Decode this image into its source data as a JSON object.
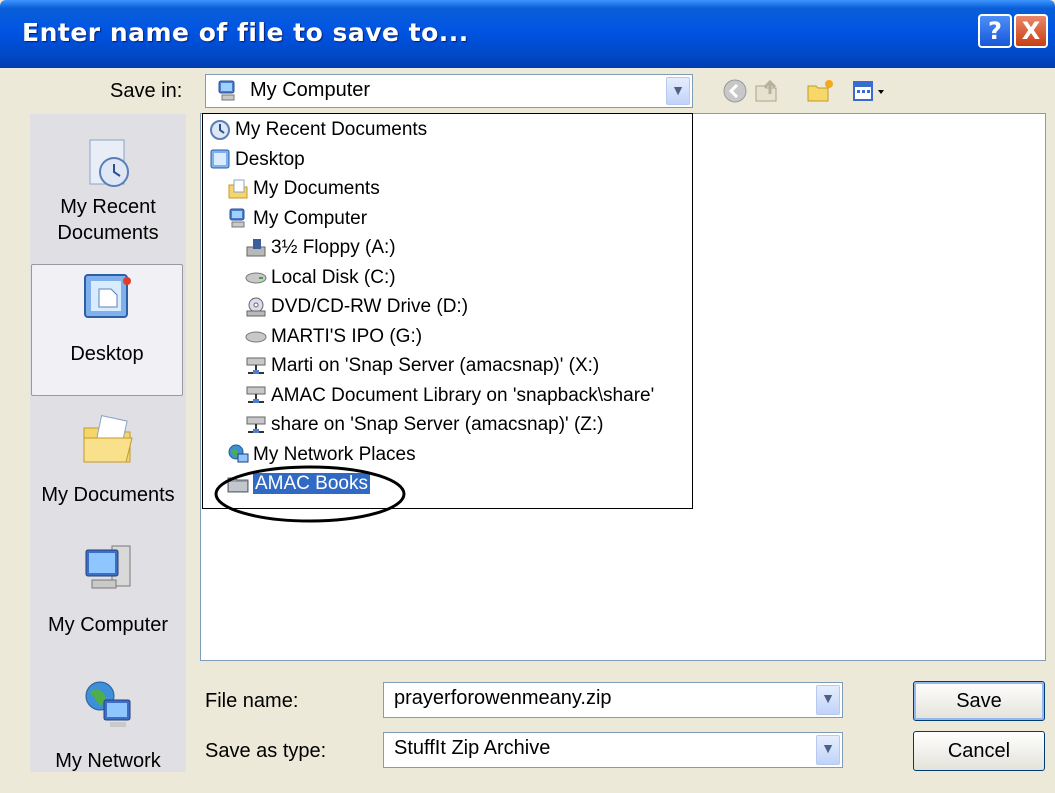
{
  "window": {
    "title": "Enter name of file to save to...",
    "help_label": "?",
    "close_label": "X"
  },
  "save_in": {
    "label": "Save in:",
    "value": "My Computer"
  },
  "toolbar": {
    "icons": [
      "back-icon",
      "up-folder-icon",
      "new-folder-icon",
      "views-menu-icon"
    ]
  },
  "places_bar": [
    {
      "label": "My Recent Documents",
      "icon": "recent-documents-icon"
    },
    {
      "label": "Desktop",
      "icon": "desktop-icon",
      "selected": true
    },
    {
      "label": "My Documents",
      "icon": "my-documents-icon"
    },
    {
      "label": "My Computer",
      "icon": "my-computer-icon"
    },
    {
      "label": "My Network",
      "icon": "my-network-icon"
    }
  ],
  "dropdown_items": [
    {
      "label": "My Recent Documents",
      "icon": "recent-documents-icon",
      "indent": 0
    },
    {
      "label": "Desktop",
      "icon": "desktop-icon",
      "indent": 0
    },
    {
      "label": "My Documents",
      "icon": "my-documents-icon",
      "indent": 1
    },
    {
      "label": "My Computer",
      "icon": "my-computer-icon",
      "indent": 1
    },
    {
      "label": "3½ Floppy (A:)",
      "icon": "floppy-drive-icon",
      "indent": 2
    },
    {
      "label": "Local Disk (C:)",
      "icon": "hard-disk-icon",
      "indent": 2
    },
    {
      "label": "DVD/CD-RW Drive (D:)",
      "icon": "cd-drive-icon",
      "indent": 2
    },
    {
      "label": "MARTI'S IPO (G:)",
      "icon": "removable-drive-icon",
      "indent": 2
    },
    {
      "label": "Marti on 'Snap Server (amacsnap)' (X:)",
      "icon": "network-drive-icon",
      "indent": 2
    },
    {
      "label": "AMAC Document Library on 'snapback\\share'",
      "icon": "network-drive-icon",
      "indent": 2
    },
    {
      "label": "share on 'Snap Server (amacsnap)' (Z:)",
      "icon": "network-drive-icon",
      "indent": 2
    },
    {
      "label": "My Network Places",
      "icon": "network-places-icon",
      "indent": 1
    },
    {
      "label": "AMAC Books",
      "icon": "folder-icon",
      "indent": 1,
      "highlighted": true
    }
  ],
  "file_name": {
    "label": "File name:",
    "value": "prayerforowenmeany.zip"
  },
  "save_as_type": {
    "label": "Save as type:",
    "value": "StuffIt Zip Archive"
  },
  "buttons": {
    "save": "Save",
    "cancel": "Cancel"
  },
  "colors": {
    "titlebar": "#0054e3",
    "dialog_bg": "#ece9d8",
    "highlight": "#316ac5",
    "annotation_circle": "#000000"
  }
}
